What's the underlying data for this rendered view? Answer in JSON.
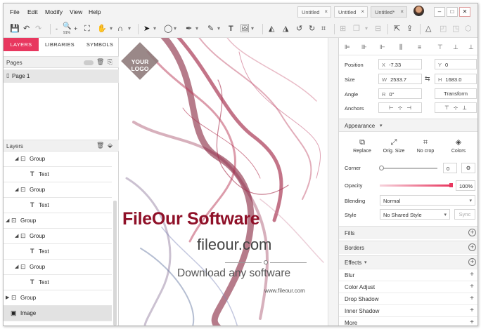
{
  "menu": [
    "File",
    "Edit",
    "Modify",
    "View",
    "Help"
  ],
  "tabs": [
    {
      "label": "Untitled",
      "active": false
    },
    {
      "label": "Untitled",
      "active": false
    },
    {
      "label": "Untitled*",
      "active": true
    }
  ],
  "toolbar": {
    "zoom_label": "91%"
  },
  "left_panel": {
    "tabs": [
      "LAYERS",
      "LIBRARIES",
      "SYMBOLS"
    ],
    "pages_label": "Pages",
    "pages": [
      "Page 1"
    ],
    "layers_label": "Layers",
    "layers": [
      {
        "label": "Group",
        "type": "group",
        "level": 1
      },
      {
        "label": "Text",
        "type": "text",
        "level": 2
      },
      {
        "label": "Group",
        "type": "group",
        "level": 1
      },
      {
        "label": "Text",
        "type": "text",
        "level": 2
      },
      {
        "label": "Group",
        "type": "group",
        "level": 0
      },
      {
        "label": "Group",
        "type": "group",
        "level": 1
      },
      {
        "label": "Text",
        "type": "text",
        "level": 2
      },
      {
        "label": "Group",
        "type": "group",
        "level": 1
      },
      {
        "label": "Text",
        "type": "text",
        "level": 2
      },
      {
        "label": "Group",
        "type": "group",
        "level": 0,
        "collapsed": true
      },
      {
        "label": "Image",
        "type": "image",
        "level": 0,
        "selected": true
      }
    ]
  },
  "canvas": {
    "logo": "YOUR LOGO",
    "headline": "FileOur Software",
    "domain": "fileour.com",
    "tagline": "Download any software",
    "url": "www.fileour.com"
  },
  "inspector": {
    "position_label": "Position",
    "x_prefix": "X",
    "x_value": "-7.33",
    "y_prefix": "Y",
    "y_value": "0",
    "size_label": "Size",
    "w_prefix": "W",
    "w_value": "2533.7",
    "h_prefix": "H",
    "h_value": "1683.0",
    "angle_label": "Angle",
    "r_prefix": "R",
    "r_value": "0°",
    "transform_label": "Transform",
    "anchors_label": "Anchors",
    "appearance_label": "Appearance",
    "appearance_items": [
      "Replace",
      "Orig. Size",
      "No crop",
      "Colors"
    ],
    "corner_label": "Corner",
    "corner_value": "0",
    "opacity_label": "Opacity",
    "opacity_value": "100%",
    "blending_label": "Blending",
    "blending_value": "Normal",
    "style_label": "Style",
    "style_value": "No Shared Style",
    "sync_label": "Sync",
    "fills_label": "Fills",
    "borders_label": "Borders",
    "effects_label": "Effects",
    "effects": [
      "Blur",
      "Color Adjust",
      "Drop Shadow",
      "Inner Shadow",
      "More"
    ]
  },
  "colors": {
    "accent": "#e8375f",
    "headline": "#8f1028"
  }
}
